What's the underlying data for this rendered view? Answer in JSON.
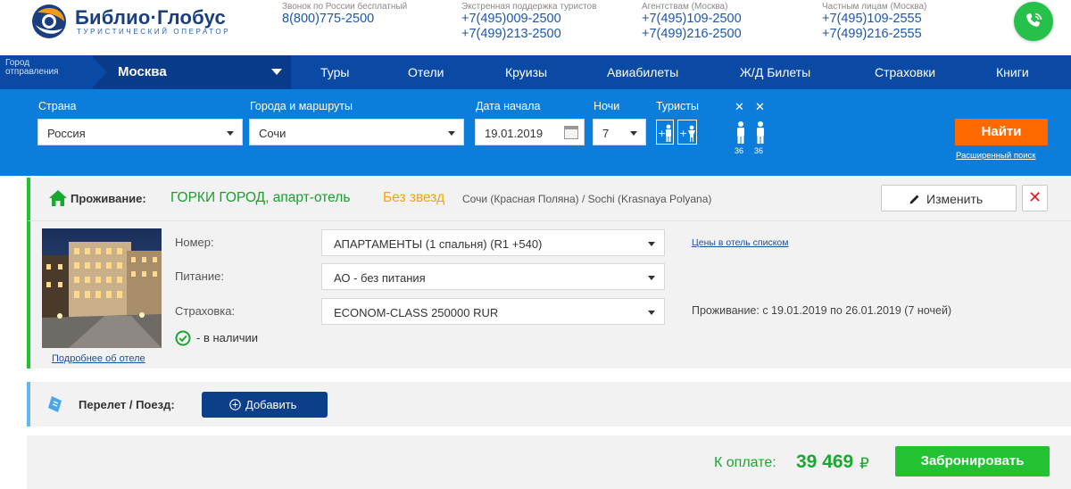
{
  "header": {
    "logo": {
      "brand": "Библио·Глобус",
      "subtitle": "ТУРИСТИЧЕСКИЙ ОПЕРАТОР"
    },
    "contacts": [
      {
        "label": "Звонок по России бесплатный",
        "phones": [
          "8(800)775-2500"
        ]
      },
      {
        "label": "Экстренная поддержка туристов",
        "phones": [
          "+7(495)009-2500",
          "+7(499)213-2500"
        ]
      },
      {
        "label": "Агентствам (Москва)",
        "phones": [
          "+7(495)109-2500",
          "+7(499)216-2500"
        ]
      },
      {
        "label": "Частным лицам (Москва)",
        "phones": [
          "+7(495)109-2555",
          "+7(499)216-2555"
        ]
      }
    ],
    "call_icon": "phone-call-icon"
  },
  "nav": {
    "city_label_1": "Город",
    "city_label_2": "отправления",
    "city": "Москва",
    "items": [
      "Туры",
      "Отели",
      "Круизы",
      "Авиабилеты",
      "Ж/Д Билеты",
      "Страховки",
      "Книги"
    ]
  },
  "search": {
    "country_label": "Страна",
    "country": "Россия",
    "cities_label": "Города и маршруты",
    "city": "Сочи",
    "date_label": "Дата начала",
    "date": "19.01.2019",
    "nights_label": "Ночи",
    "nights": "7",
    "tourists_label": "Туристы",
    "tourist_ages": [
      "36",
      "36"
    ],
    "find_label": "Найти",
    "advanced_link": "Расширенный поиск"
  },
  "accommodation": {
    "label": "Проживание:",
    "hotel_name": "ГОРКИ ГОРОД, апарт-отель",
    "stars": "Без звезд",
    "location": "Сочи (Красная Поляна) / Sochi (Krasnaya Polyana)",
    "edit_label": "Изменить",
    "room_label": "Номер:",
    "room": "АПАРТАМЕНТЫ (1 спальня) (R1 +540)",
    "meal_label": "Питание:",
    "meal": "АО - без питания",
    "insurance_label": "Страховка:",
    "insurance": "ECONOM-CLASS 250000 RUR",
    "availability": "- в наличии",
    "hotel_link": "Подробнее об отеле",
    "prices_link": "Цены в отель списком",
    "stay_info": "Проживание: с 19.01.2019 по 26.01.2019 (7 ночей)"
  },
  "flight": {
    "label": "Перелет / Поезд:",
    "add_label": "Добавить"
  },
  "total": {
    "label": "К оплате:",
    "amount": "39 469",
    "currency": "₽",
    "book_label": "Забронировать"
  },
  "colors": {
    "nav_bg": "#0a4aa5",
    "search_bg": "#0c7ddb",
    "find_button": "#ff6a00",
    "accent_green": "#22c233",
    "price_green": "#1aa830",
    "stars_orange": "#f3a700"
  }
}
